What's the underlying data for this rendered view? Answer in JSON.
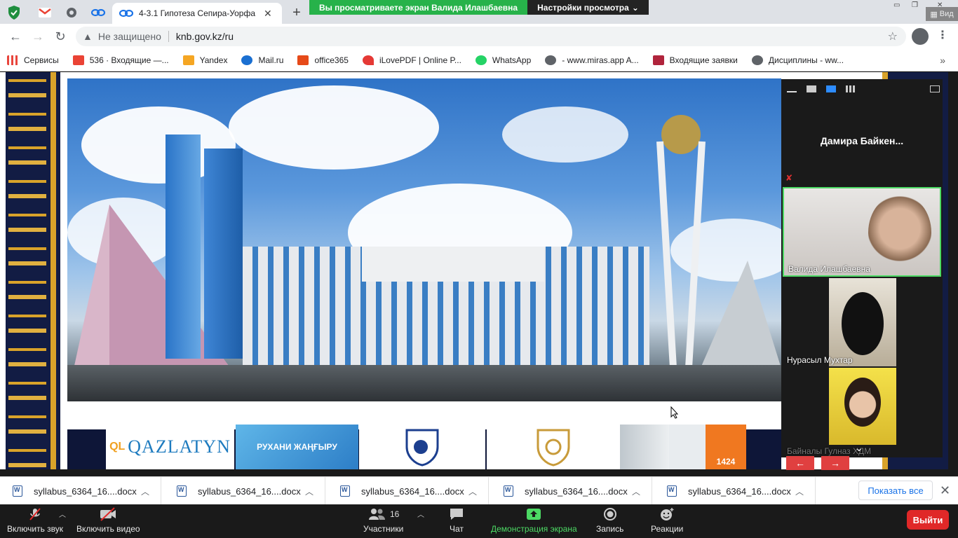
{
  "browser": {
    "tabs": [
      {
        "label": "4-3.1 Гипотеза Сепира-Уорфа |",
        "close": "✕"
      }
    ],
    "new_tab": "+",
    "address": {
      "security_label": "Не защищено",
      "url": "knb.gov.kz/ru"
    },
    "bookmarks": [
      {
        "label": "Сервисы",
        "color": "#e8453c"
      },
      {
        "label": "536 · Входящие —...",
        "color": "#ea4335"
      },
      {
        "label": "Yandex",
        "color": "#f5a623"
      },
      {
        "label": "Mail.ru",
        "color": "#1a6fd1"
      },
      {
        "label": "office365",
        "color": "#e64a19"
      },
      {
        "label": "iLovePDF | Online P...",
        "color": "#e53935"
      },
      {
        "label": "WhatsApp",
        "color": "#25d366"
      },
      {
        "label": "- www.miras.app A...",
        "color": "#5f6368"
      },
      {
        "label": "Входящие заявки",
        "color": "#b0243c"
      },
      {
        "label": "Дисциплины - ww...",
        "color": "#5f6368"
      }
    ],
    "bookmarks_more": "»"
  },
  "zoom_share": {
    "banner": "Вы просматриваете экран Валида Илашбаевна",
    "settings": "Настройки просмотра"
  },
  "view_button": "Вид",
  "participants_panel": {
    "active_speaker": "Дамира  Байкен...",
    "tiles": [
      {
        "name": "Валида Илашбаевна"
      },
      {
        "name": "Нурасыл Мухтар"
      },
      {
        "name": "Байналы Гулназ ХДМ"
      }
    ]
  },
  "page": {
    "logos": [
      {
        "text": "QAZLATYN"
      },
      {
        "text": "РУХАНИ ЖАҢҒЫРУ"
      },
      {
        "text": "1424"
      }
    ]
  },
  "downloads": {
    "items": [
      {
        "label": "syllabus_6364_16....docx"
      },
      {
        "label": "syllabus_6364_16....docx"
      },
      {
        "label": "syllabus_6364_16....docx"
      },
      {
        "label": "syllabus_6364_16....docx"
      },
      {
        "label": "syllabus_6364_16....docx"
      }
    ],
    "show_all": "Показать все",
    "close": "✕"
  },
  "zoom_controls": {
    "unmute": "Включить звук",
    "start_video": "Включить видео",
    "participants": "Участники",
    "participants_count": "16",
    "chat": "Чат",
    "share": "Демонстрация экрана",
    "record": "Запись",
    "reactions": "Реакции",
    "leave": "Выйти"
  },
  "colors": {
    "share_green": "#27b24a",
    "leave_red": "#e02828",
    "active_tile_border": "#4cd964",
    "ornament_navy": "#121c44",
    "ornament_gold": "#d9a32a"
  }
}
